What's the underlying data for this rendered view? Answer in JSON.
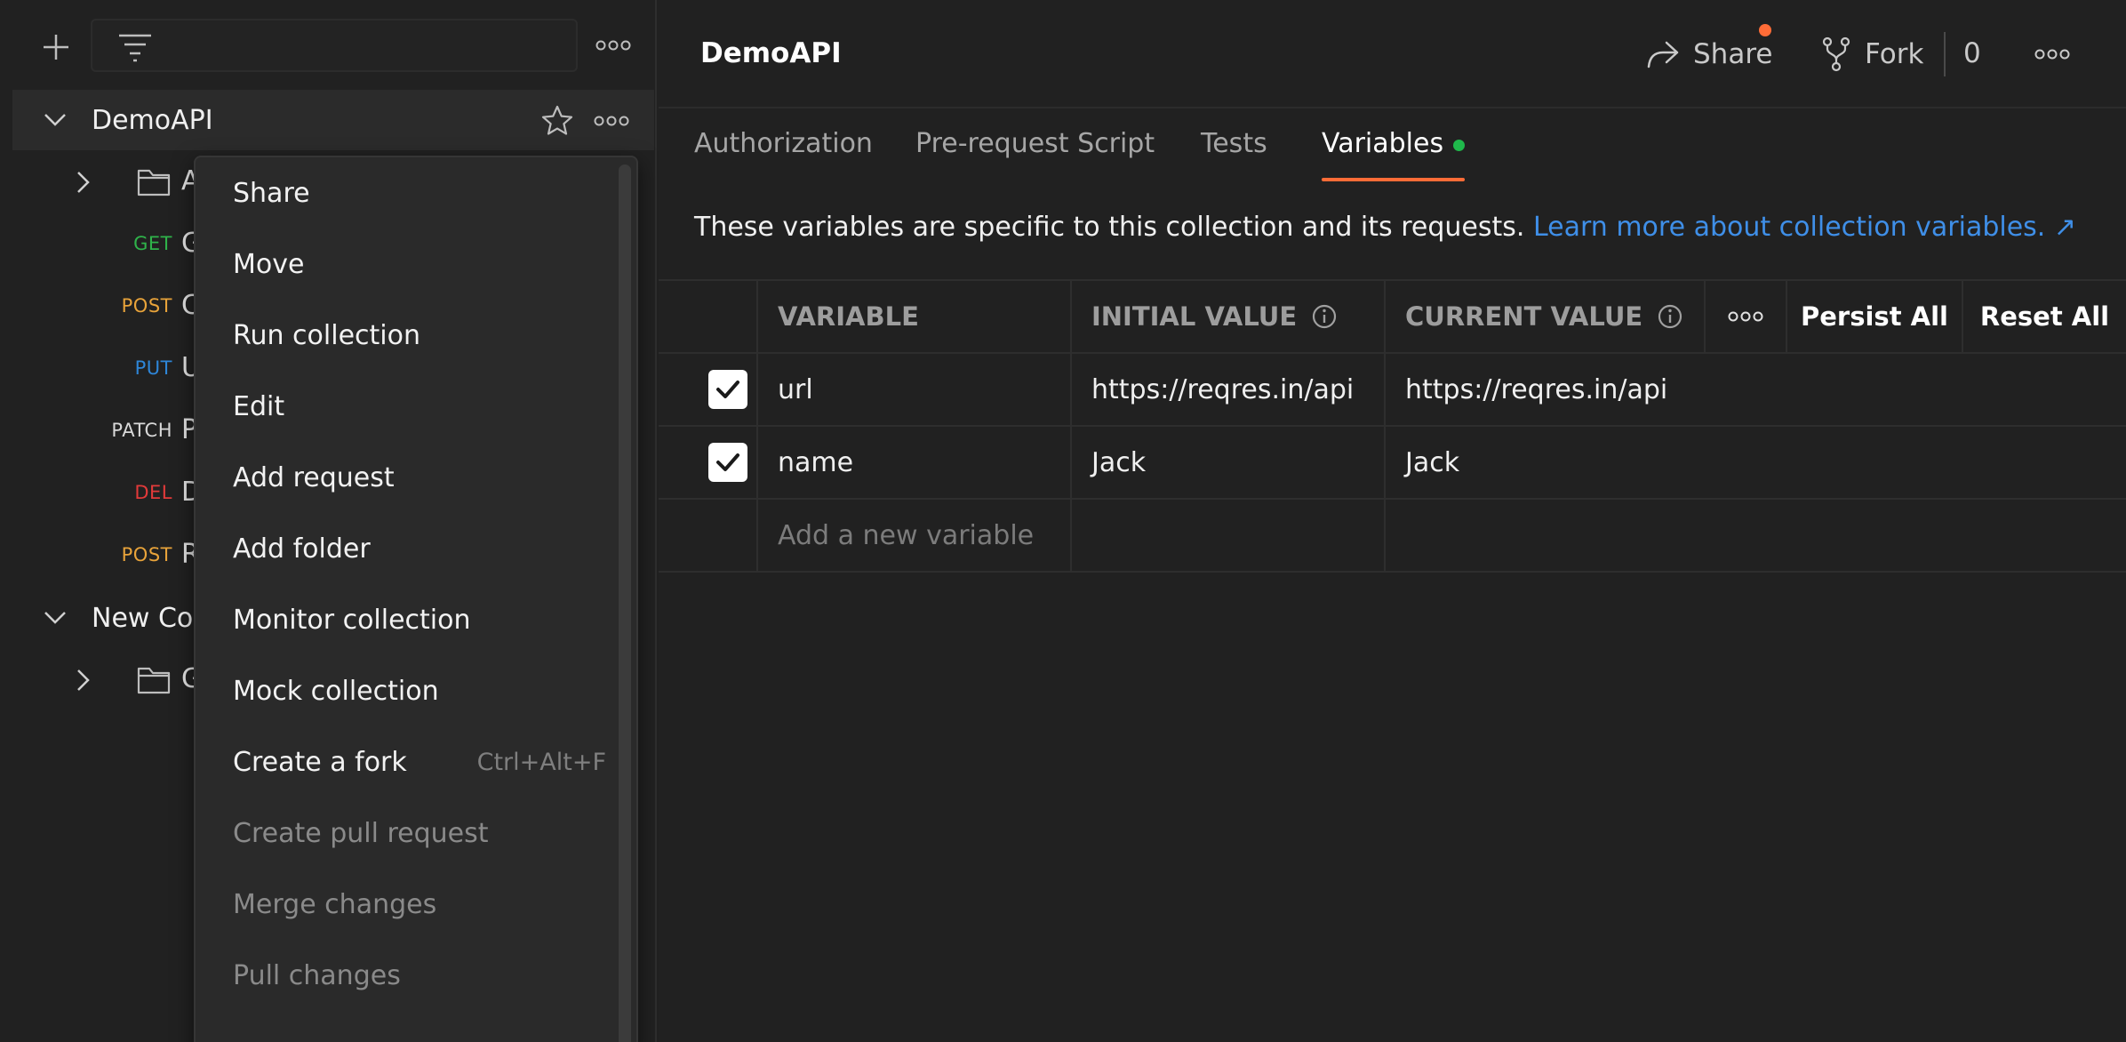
{
  "sidebar": {
    "collections": [
      {
        "name": "DemoAPI",
        "expanded": true,
        "folder": "A",
        "requests": [
          {
            "method": "GET",
            "name": "G"
          },
          {
            "method": "POST",
            "name": "C"
          },
          {
            "method": "PUT",
            "name": "U"
          },
          {
            "method": "PATCH",
            "name": "P"
          },
          {
            "method": "DEL",
            "name": "D"
          },
          {
            "method": "POST",
            "name": "R"
          }
        ]
      },
      {
        "name": "New Co",
        "expanded": true,
        "folder": "G"
      }
    ]
  },
  "context_menu": {
    "items": [
      {
        "label": "Share",
        "enabled": true
      },
      {
        "label": "Move",
        "enabled": true
      },
      {
        "label": "Run collection",
        "enabled": true
      },
      {
        "label": "Edit",
        "enabled": true
      },
      {
        "label": "Add request",
        "enabled": true
      },
      {
        "label": "Add folder",
        "enabled": true
      },
      {
        "label": "Monitor collection",
        "enabled": true
      },
      {
        "label": "Mock collection",
        "enabled": true
      },
      {
        "label": "Create a fork",
        "enabled": true,
        "shortcut": "Ctrl+Alt+F"
      },
      {
        "label": "Create pull request",
        "enabled": false
      },
      {
        "label": "Merge changes",
        "enabled": false
      },
      {
        "label": "Pull changes",
        "enabled": false
      }
    ]
  },
  "header": {
    "title": "DemoAPI",
    "share_label": "Share",
    "fork_label": "Fork",
    "fork_count": "0"
  },
  "tabs": [
    {
      "label": "Authorization",
      "active": false
    },
    {
      "label": "Pre-request Script",
      "active": false
    },
    {
      "label": "Tests",
      "active": false
    },
    {
      "label": "Variables",
      "active": true,
      "has_dot": true
    }
  ],
  "description": {
    "text": "These variables are specific to this collection and its requests.",
    "link": "Learn more about collection variables. ↗"
  },
  "variables_table": {
    "columns": {
      "variable": "VARIABLE",
      "initial_value": "INITIAL VALUE",
      "current_value": "CURRENT VALUE",
      "persist_all": "Persist All",
      "reset_all": "Reset All"
    },
    "rows": [
      {
        "checked": true,
        "variable": "url",
        "initial_value": "https://reqres.in/api",
        "current_value": "https://reqres.in/api"
      },
      {
        "checked": true,
        "variable": "name",
        "initial_value": "Jack",
        "current_value": "Jack"
      }
    ],
    "new_placeholder": "Add a new variable"
  },
  "colors": {
    "accent": "#ff6c37",
    "link": "#3f8fe8",
    "get": "#2fb34a",
    "post": "#e8a33a",
    "put": "#2e86d8",
    "del": "#e23a3a",
    "status_dot": "#1fb84b"
  }
}
